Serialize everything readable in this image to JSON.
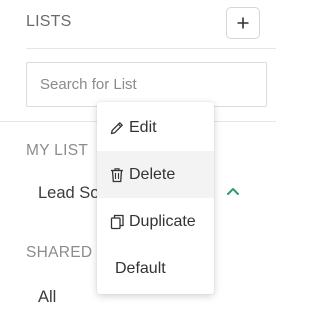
{
  "header": {
    "title": "LISTS",
    "add_icon": "plus-icon"
  },
  "search": {
    "placeholder": "Search for List",
    "value": ""
  },
  "sections": {
    "my_list": {
      "label": "MY LIST",
      "items": [
        {
          "label": "Lead So"
        }
      ]
    },
    "shared": {
      "label": "SHARED",
      "items": [
        {
          "label": "All"
        }
      ]
    }
  },
  "menu": {
    "items": [
      {
        "label": "Edit",
        "icon": "pencil-icon"
      },
      {
        "label": "Delete",
        "icon": "trash-icon"
      },
      {
        "label": "Duplicate",
        "icon": "copy-icon"
      },
      {
        "label": "Default"
      }
    ]
  },
  "colors": {
    "accent": "#2e9e6b",
    "border": "#d6d6d6",
    "muted": "#8c8c8c"
  }
}
